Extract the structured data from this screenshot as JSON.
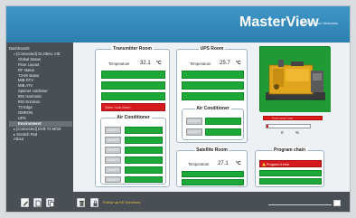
{
  "app": {
    "brand": "MasterView",
    "brand_sub": "by Westermo Networks"
  },
  "sidebar": {
    "root": "Dashboards",
    "items": [
      {
        "label": "▿ [Connected] GLOBAL VIE",
        "level": 1
      },
      {
        "label": "Global Status",
        "level": 2
      },
      {
        "label": "Floor Layout",
        "level": 2
      },
      {
        "label": "RF status",
        "level": 2
      },
      {
        "label": "T3-60 status",
        "level": 2
      },
      {
        "label": "MIB DTV",
        "level": 2
      },
      {
        "label": "MIB ATV",
        "level": 2
      },
      {
        "label": "Spinner combiner",
        "level": 2
      },
      {
        "label": "IRD Harmonic",
        "level": 2
      },
      {
        "label": "IRD Ericsson",
        "level": 2
      },
      {
        "label": "T3 Edge",
        "level": 2
      },
      {
        "label": "OMRON",
        "level": 2
      },
      {
        "label": "UPS",
        "level": 2
      },
      {
        "label": "Environment",
        "level": 2,
        "selected": true
      },
      {
        "label": "▸ [Connected] DVB T3 MOD",
        "level": 1
      },
      {
        "label": "▸ Scratch Pad",
        "level": 1
      },
      {
        "label": "About",
        "level": 1
      }
    ]
  },
  "transmitter_room": {
    "title": "Transmitter Room",
    "temp_label": "Temperature",
    "temp_value": "32.1",
    "temp_unit": "°C",
    "alarm_label": "Water Leak Alarm"
  },
  "air_conditioner_tx": {
    "title": "Air Conditioner",
    "buttons": [
      "ON/OFF",
      "ON/OFF",
      "ON/OFF",
      "ON/OFF",
      "ON/OFF",
      "ON/OFF"
    ]
  },
  "ups_room": {
    "title": "UPS Room",
    "temp_label": "Temperature",
    "temp_value": "25.7",
    "temp_unit": "°C"
  },
  "air_conditioner_ups": {
    "title": "Air Conditioner",
    "buttons": [
      "ON/OFF",
      "ON/OFF"
    ]
  },
  "satellite_room": {
    "title": "Satellite Room",
    "temp_label": "Temperature",
    "temp_value": "27.1",
    "temp_unit": "°C"
  },
  "program_chain": {
    "title": "Program chain",
    "alarm_label": "Program A error"
  },
  "generator": {
    "fuel_label": "Fuel Level Low",
    "fuel_value": "0",
    "fuel_unit": "%"
  },
  "footer": {
    "status_text": "Follow up KE Schemes"
  },
  "colors": {
    "header_blue": "#2c7fb0",
    "ok_green": "#1fa83a",
    "alarm_red": "#d6191c",
    "sidebar_gray": "#4a4f55"
  }
}
